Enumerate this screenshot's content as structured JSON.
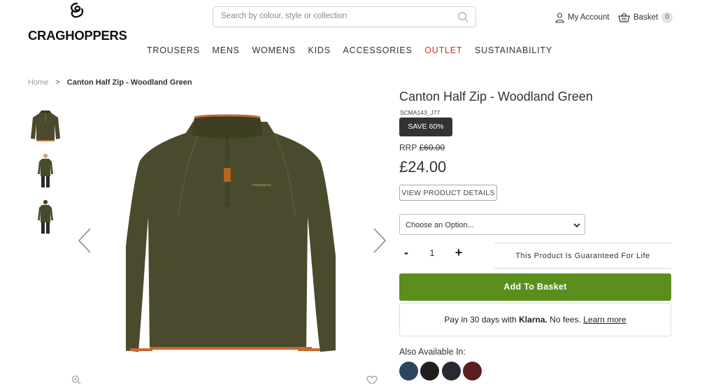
{
  "header": {
    "logo_text": "CRAGHOPPERS",
    "search_placeholder": "Search by colour, style or collection",
    "account_label": "My Account",
    "basket_label": "Basket",
    "basket_count": "0"
  },
  "nav": {
    "items": [
      "TROUSERS",
      "MENS",
      "WOMENS",
      "KIDS",
      "ACCESSORIES",
      "OUTLET",
      "SUSTAINABILITY"
    ]
  },
  "breadcrumb": {
    "home": "Home",
    "separator": ">",
    "current": "Canton Half Zip - Woodland Green"
  },
  "product": {
    "title": "Canton Half Zip - Woodland Green",
    "sku": "SCMA143_J77",
    "save_badge": "SAVE 60%",
    "rrp_label": "RRP",
    "rrp_value": "£60.00",
    "price": "£24.00",
    "details_button": "VIEW PRODUCT DETAILS",
    "option_select": "Choose an Option...",
    "qty_minus": "-",
    "qty_value": "1",
    "qty_plus": "+",
    "guarantee": "This Product Is Guaranteed For Life",
    "add_to_basket": "Add To Basket",
    "klarna_prefix": "Pay in 30 days with",
    "klarna_brand": "Klarna.",
    "klarna_suffix": "No fees.",
    "klarna_link": "Learn more",
    "also_available": "Also Available In:"
  },
  "colors": {
    "accent_green": "#5a8f1e",
    "outlet_red": "#d92a2a",
    "jacket_green": "#4a4a2c",
    "trim_orange": "#c96a2e",
    "swatches": [
      "#2f4460",
      "#1f1f1f",
      "#262a33",
      "#5a1f1f"
    ]
  },
  "icons": {
    "logo": "craghoppers-logo-icon",
    "search": "search-icon",
    "account": "user-icon",
    "basket": "basket-icon",
    "prev": "chevron-left-icon",
    "next": "chevron-right-icon",
    "zoom": "zoom-icon",
    "wishlist": "heart-icon"
  }
}
